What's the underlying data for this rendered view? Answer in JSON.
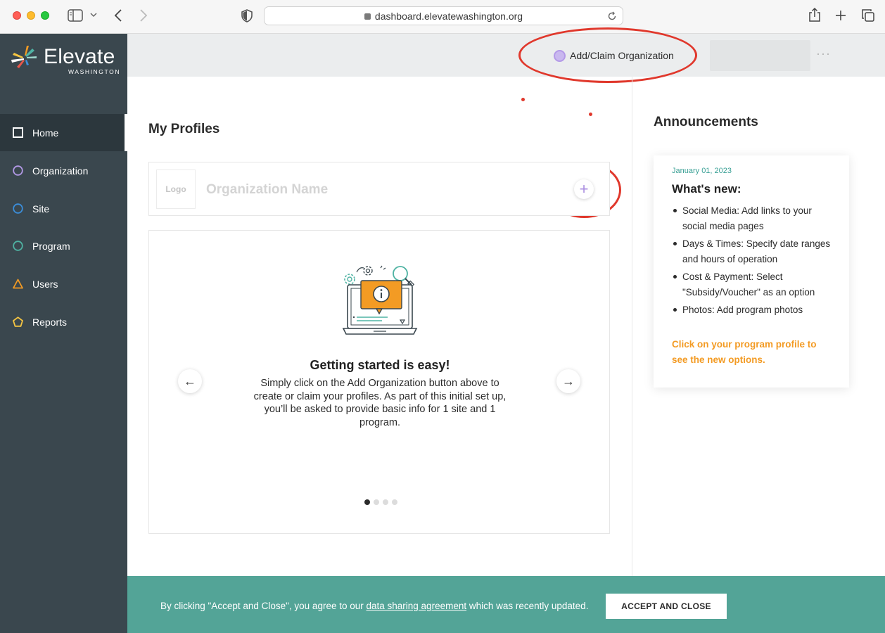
{
  "browser": {
    "url": "dashboard.elevatewashington.org"
  },
  "brand": {
    "name": "Elevate",
    "subtitle": "WASHINGTON"
  },
  "sidebar": {
    "items": [
      {
        "label": "Home",
        "icon": "square-icon",
        "color": "#ffffff",
        "active": true
      },
      {
        "label": "Organization",
        "icon": "circle-icon",
        "color": "#b49ae8"
      },
      {
        "label": "Site",
        "icon": "circle-icon",
        "color": "#3b8fdc"
      },
      {
        "label": "Program",
        "icon": "circle-icon",
        "color": "#4fb3a3"
      },
      {
        "label": "Users",
        "icon": "triangle-icon",
        "color": "#f39b24"
      },
      {
        "label": "Reports",
        "icon": "pentagon-icon",
        "color": "#f5c542"
      }
    ]
  },
  "topbar": {
    "add_claim_label": "Add/Claim Organization",
    "more_label": "···"
  },
  "profiles": {
    "title": "My Profiles",
    "logo_label": "Logo",
    "org_name_placeholder": "Organization Name",
    "add_label": "+"
  },
  "carousel": {
    "title": "Getting started is easy!",
    "body": "Simply click on the Add Organization button above to create or claim your profiles. As part of this initial set up, you’ll be asked to provide basic info for 1 site and 1 program.",
    "prev_label": "←",
    "next_label": "→",
    "slide_count": 4,
    "active_slide": 1
  },
  "announcements": {
    "title": "Announcements",
    "date": "January 01, 2023",
    "heading": "What's new:",
    "items": [
      "Social Media: Add links to your social media pages",
      "Days & Times: Specify date ranges and hours of operation",
      "Cost & Payment: Select \"Subsidy/Voucher\" as an option",
      "Photos: Add program photos"
    ],
    "cta": "Click on your program profile to see the new options.",
    "cta_color": "#f39b24"
  },
  "banner": {
    "text_before": "By clicking \"Accept and Close\", you agree to our ",
    "link_text": "data sharing agreement",
    "text_after": " which was recently updated.",
    "button_label": "ACCEPT AND CLOSE",
    "background": "#53a497"
  },
  "colors": {
    "sidebar_bg": "#3a474e",
    "annotation_red": "#e0382c",
    "accent_purple": "#b49ae8"
  }
}
